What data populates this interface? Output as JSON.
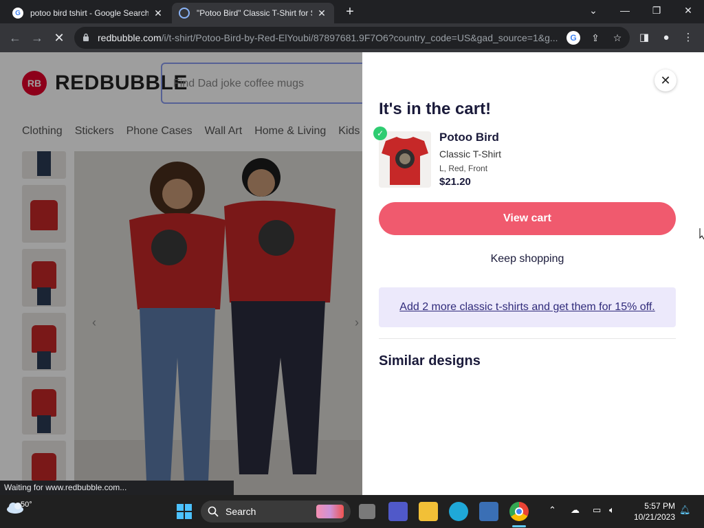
{
  "browser": {
    "tabs": [
      {
        "title": "potoo bird tshirt - Google Search",
        "active": false
      },
      {
        "title": "\"Potoo Bird\" Classic T-Shirt for Sale by Red-ElYoubi",
        "active": true
      }
    ],
    "new_tab": "+",
    "window_controls": {
      "dropdown": "⌄",
      "minimize": "—",
      "restore": "❐",
      "close": "✕"
    },
    "url_domain": "redbubble.com",
    "url_path": "/i/t-shirt/Potoo-Bird-by-Red-ElYoubi/87897681.9F7O6?country_code=US&gad_source=1&g..."
  },
  "site": {
    "logo_mark": "RB",
    "logo_text": "REDBUBBLE",
    "search_placeholder": "Find Dad joke coffee mugs",
    "categories": [
      "Clothing",
      "Stickers",
      "Phone Cases",
      "Wall Art",
      "Home & Living",
      "Kids &"
    ]
  },
  "status_bar": "Waiting for www.redbubble.com...",
  "cart": {
    "title": "It's in the cart!",
    "product_name": "Potoo Bird",
    "product_type": "Classic T-Shirt",
    "product_options": "L, Red, Front",
    "price": "$21.20",
    "view_cart_label": "View cart",
    "keep_shopping_label": "Keep shopping",
    "promo_text": "Add 2 more classic t-shirts and get them for 15% off.",
    "similar_heading": "Similar designs"
  },
  "taskbar": {
    "temperature": "50°",
    "search_label": "Search",
    "time": "5:57 PM",
    "date": "10/21/2023"
  },
  "colors": {
    "accent_button": "#f05a6e",
    "promo_bg": "#ece9fb",
    "check_green": "#2ecc71",
    "brand_red": "#e4002b"
  }
}
